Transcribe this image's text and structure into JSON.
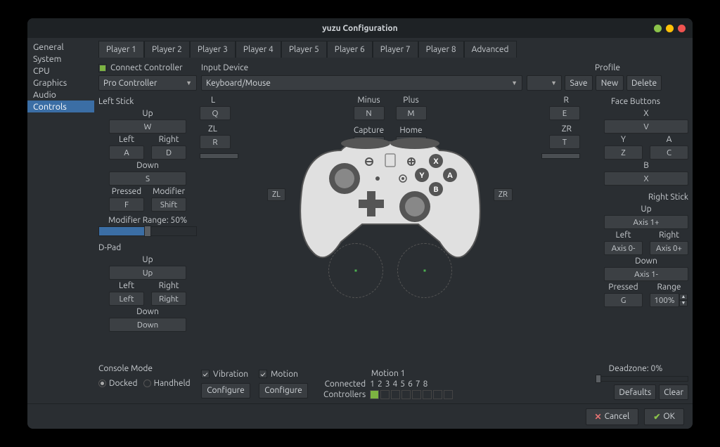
{
  "window": {
    "title": "yuzu Configuration"
  },
  "sidebar": {
    "items": [
      "General",
      "System",
      "CPU",
      "Graphics",
      "Audio",
      "Controls"
    ],
    "selected": 5
  },
  "tabs": {
    "items": [
      "Player 1",
      "Player 2",
      "Player 3",
      "Player 4",
      "Player 5",
      "Player 6",
      "Player 7",
      "Player 8",
      "Advanced"
    ],
    "selected": 0
  },
  "top": {
    "connect_label": "Connect Controller",
    "controller_type": "Pro Controller",
    "input_device_label": "Input Device",
    "input_device": "Keyboard/Mouse",
    "profile_label": "Profile",
    "profile": "",
    "save": "Save",
    "new": "New",
    "delete": "Delete"
  },
  "left_stick": {
    "title": "Left Stick",
    "up_l": "Up",
    "up_b": "W",
    "left_l": "Left",
    "left_b": "A",
    "right_l": "Right",
    "right_b": "D",
    "down_l": "Down",
    "down_b": "S",
    "pressed_l": "Pressed",
    "pressed_b": "F",
    "modifier_l": "Modifier",
    "modifier_b": "Shift",
    "mod_range": "Modifier Range: 50%"
  },
  "dpad": {
    "title": "D-Pad",
    "up_l": "Up",
    "up_b": "Up",
    "left_l": "Left",
    "left_b": "Left",
    "right_l": "Right",
    "right_b": "Right",
    "down_l": "Down",
    "down_b": "Down"
  },
  "console": {
    "title": "Console Mode",
    "docked": "Docked",
    "handheld": "Handheld"
  },
  "triggers": {
    "L_l": "L",
    "L_b": "Q",
    "ZL_l": "ZL",
    "ZL_b": "R",
    "R_l": "R",
    "R_b": "E",
    "ZR_l": "ZR",
    "ZR_b": "T"
  },
  "misc": {
    "minus_l": "Minus",
    "minus_b": "N",
    "plus_l": "Plus",
    "plus_b": "M",
    "capture_l": "Capture",
    "capture_b": "",
    "home_l": "Home",
    "home_b": ""
  },
  "face": {
    "title": "Face Buttons",
    "X_l": "X",
    "X_b": "V",
    "Y_l": "Y",
    "Y_b": "Z",
    "A_l": "A",
    "A_b": "C",
    "B_l": "B",
    "B_b": "X"
  },
  "right_stick": {
    "title": "Right Stick",
    "up_l": "Up",
    "up_b": "Axis 1+",
    "left_l": "Left",
    "left_b": "Axis 0-",
    "right_l": "Right",
    "right_b": "Axis 0+",
    "down_l": "Down",
    "down_b": "Axis 1-",
    "pressed_l": "Pressed",
    "pressed_b": "G",
    "range_l": "Range",
    "range_v": "100%",
    "deadzone": "Deadzone: 0%"
  },
  "motion": {
    "vibration": "Vibration",
    "motion": "Motion",
    "configure": "Configure",
    "motion1": "Motion 1",
    "connected": "Connected",
    "controllers": "Controllers",
    "nums": [
      "1",
      "2",
      "3",
      "4",
      "5",
      "6",
      "7",
      "8"
    ]
  },
  "bottom": {
    "defaults": "Defaults",
    "clear": "Clear",
    "cancel": "Cancel",
    "ok": "OK"
  },
  "zl": "ZL",
  "zr": "ZR"
}
